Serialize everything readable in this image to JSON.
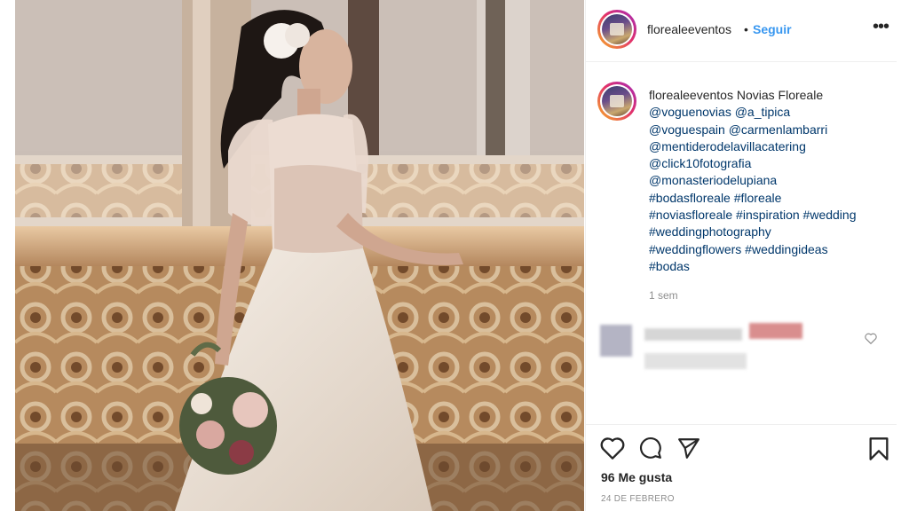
{
  "post": {
    "username": "floreale​eventos",
    "follow_label": "Seguir",
    "dot": "•",
    "more": "•••"
  },
  "caption": {
    "username": "florealeeventos",
    "text": "Novias Floreale",
    "mentions_line1": [
      "@voguenovias",
      "@a_tipica"
    ],
    "mentions_line2": [
      "@voguespain",
      "@carmenlambarri"
    ],
    "mention_3": "@mentiderodelavillacatering",
    "mention_4": "@click10fotografia",
    "mention_5": "@monasteriodelupiana",
    "tags_line1": "#bodasfloreale #floreale",
    "tags_line2": "#noviasfloreale #inspiration #wedding",
    "tags_line3": "#weddingphotography",
    "tags_line4": "#weddingflowers #weddingideas",
    "tags_line5": "#bodas",
    "time": "1 sem"
  },
  "footer": {
    "likes": "96 Me gusta",
    "date": "24 DE FEBRERO"
  },
  "icons": {
    "like": "heart-icon",
    "comment": "comment-icon",
    "share": "paper-plane-icon",
    "save": "bookmark-icon",
    "more": "more-options-icon"
  },
  "colors": {
    "link": "#00376b",
    "follow": "#3897f0",
    "muted": "#8e8e8e"
  }
}
